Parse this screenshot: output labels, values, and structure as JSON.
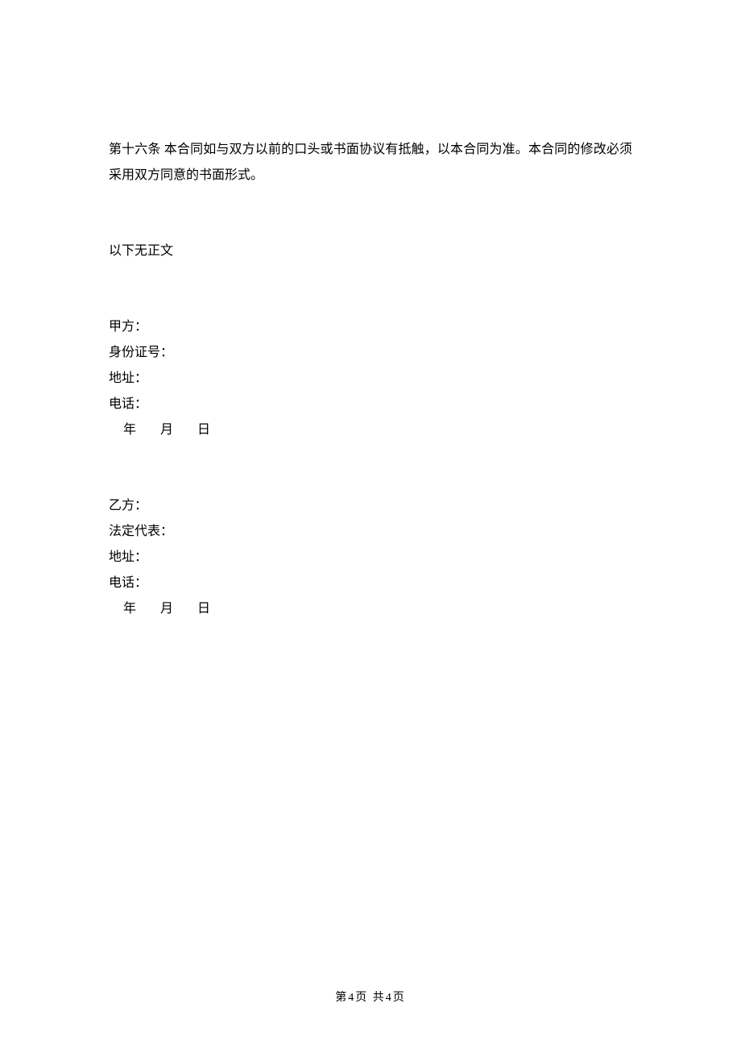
{
  "article": {
    "heading": "第十六条",
    "body": "本合同如与双方以前的口头或书面协议有抵触，以本合同为准。本合同的修改必须采用双方同意的书面形式。"
  },
  "no_more_text": "以下无正文",
  "party_a": {
    "title": "甲方：",
    "id_label": "身份证号：",
    "address_label": "地址：",
    "phone_label": "电话：",
    "date": {
      "year": "年",
      "month": "月",
      "day": "日"
    }
  },
  "party_b": {
    "title": "乙方：",
    "rep_label": "法定代表：",
    "address_label": "地址：",
    "phone_label": "电话：",
    "date": {
      "year": "年",
      "month": "月",
      "day": "日"
    }
  },
  "footer": {
    "prefix": "第",
    "current": "4",
    "mid": "页 共",
    "total": "4",
    "suffix": "页"
  }
}
